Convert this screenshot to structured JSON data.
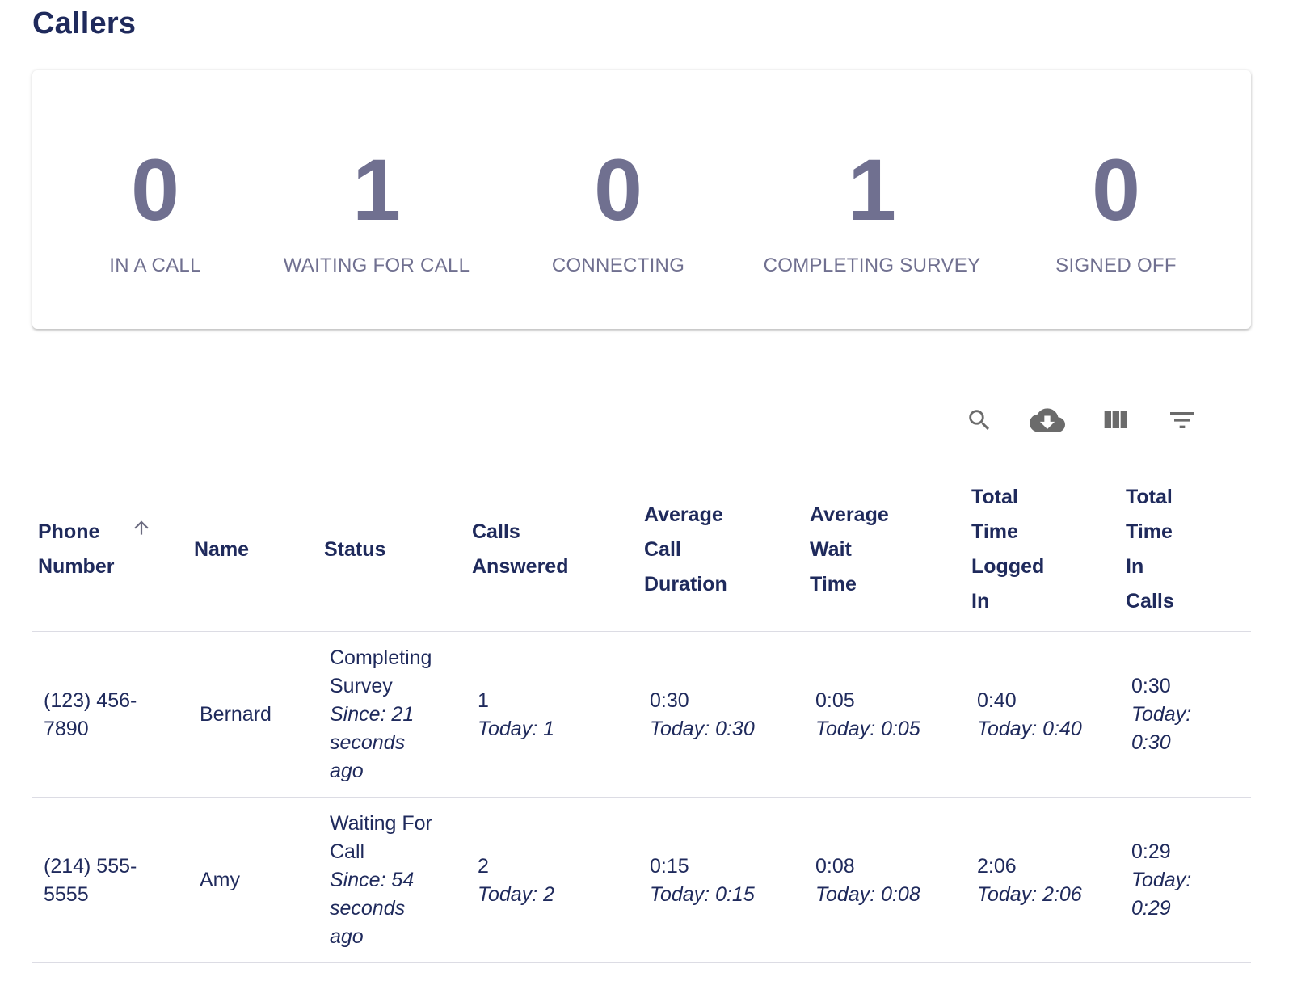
{
  "page": {
    "title": "Callers"
  },
  "stats": [
    {
      "value": "0",
      "label": "IN A CALL"
    },
    {
      "value": "1",
      "label": "WAITING FOR CALL"
    },
    {
      "value": "0",
      "label": "CONNECTING"
    },
    {
      "value": "1",
      "label": "COMPLETING SURVEY"
    },
    {
      "value": "0",
      "label": "SIGNED OFF"
    }
  ],
  "toolbar": {
    "icons": [
      "search-icon",
      "cloud-download-icon",
      "view-column-icon",
      "filter-list-icon"
    ]
  },
  "table": {
    "sort": {
      "column": "Phone Number",
      "direction": "ascending",
      "icon": "arrow-up-icon"
    },
    "columns": [
      "Phone\nNumber",
      "Name",
      "Status",
      "Calls\nAnswered",
      "Average\nCall\nDuration",
      "Average\nWait\nTime",
      "Total\nTime\nLogged\nIn",
      "Total\nTime\nIn\nCalls"
    ],
    "rows": [
      {
        "phone": "(123) 456-\n7890",
        "name": "Bernard",
        "status": "Completing\nSurvey",
        "status_since": "Since: 21\nseconds\nago",
        "calls": "1",
        "calls_today": "Today: 1",
        "avg_call": "0:30",
        "avg_call_today": "Today: 0:30",
        "avg_wait": "0:05",
        "avg_wait_today": "Today: 0:05",
        "logged": "0:40",
        "logged_today": "Today: 0:40",
        "in_calls": "0:30",
        "in_calls_today": "Today:\n0:30"
      },
      {
        "phone": "(214) 555-\n5555",
        "name": "Amy",
        "status": "Waiting For\nCall",
        "status_since": "Since: 54\nseconds\nago",
        "calls": "2",
        "calls_today": "Today: 2",
        "avg_call": "0:15",
        "avg_call_today": "Today: 0:15",
        "avg_wait": "0:08",
        "avg_wait_today": "Today: 0:08",
        "logged": "2:06",
        "logged_today": "Today: 2:06",
        "in_calls": "0:29",
        "in_calls_today": "Today:\n0:29"
      }
    ]
  },
  "colors": {
    "title": "#1f2a5c",
    "stat": "#707090",
    "text": "#1f2a5c",
    "icon": "#6b6b6b"
  }
}
